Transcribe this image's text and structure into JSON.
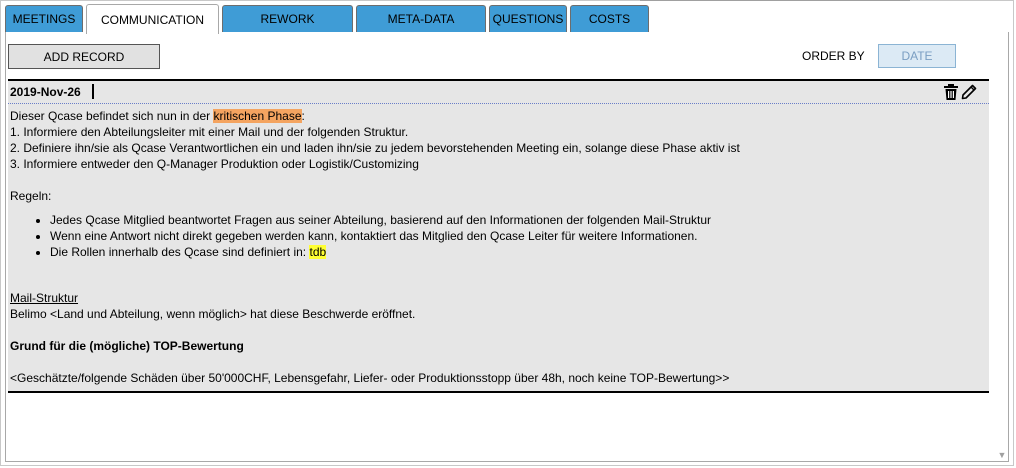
{
  "tabs": [
    {
      "label": "MEETINGS",
      "active": false
    },
    {
      "label": "COMMUNICATION",
      "active": true
    },
    {
      "label": "REWORK",
      "active": false
    },
    {
      "label": "META-DATA",
      "active": false
    },
    {
      "label": "QUESTIONS",
      "active": false
    },
    {
      "label": "COSTS",
      "active": false
    }
  ],
  "toolbar": {
    "add_record_label": "ADD RECORD",
    "order_by_label": "ORDER BY",
    "date_button_label": "DATE"
  },
  "record": {
    "date": "2019-Nov-26",
    "icons": [
      "trash-icon",
      "pencil-icon"
    ],
    "intro_pre": "Dieser Qcase befindet sich nun in der ",
    "intro_highlight": "kritischen Phase",
    "intro_post": ":",
    "steps": [
      "1. Informiere den Abteilungsleiter mit einer Mail und der folgenden Struktur.",
      "2. Definiere ihn/sie als Qcase Verantwortlichen ein und laden ihn/sie zu jedem bevorstehenden Meeting ein, solange diese Phase aktiv ist",
      "3. Informiere entweder den Q-Manager Produktion oder Logistik/Customizing"
    ],
    "rules_heading": "Regeln:",
    "rules": [
      "Jedes Qcase Mitglied beantwortet Fragen aus seiner Abteilung, basierend auf den Informationen der folgenden Mail-Struktur",
      "Wenn eine Antwort nicht direkt gegeben werden kann, kontaktiert das Mitglied den Qcase Leiter für weitere Informationen."
    ],
    "rule_last_pre": "Die Rollen innerhalb des Qcase sind definiert in: ",
    "rule_last_highlight": "tdb",
    "mail_heading": "Mail-Struktur",
    "mail_line": "Belimo <Land und Abteilung, wenn möglich> hat diese Beschwerde eröffnet.",
    "top_heading": "Grund für die (mögliche) TOP-Bewertung",
    "top_line": "<Geschätzte/folgende Schäden über 50'000CHF, Lebensgefahr, Liefer- oder Produktionsstopp über 48h, noch keine TOP-Bewertung>>"
  },
  "colors": {
    "tab_inactive": "#3f9cd6",
    "highlight_orange": "#f4a460",
    "highlight_yellow": "#ffff33",
    "record_bg": "#e6e6e6"
  }
}
